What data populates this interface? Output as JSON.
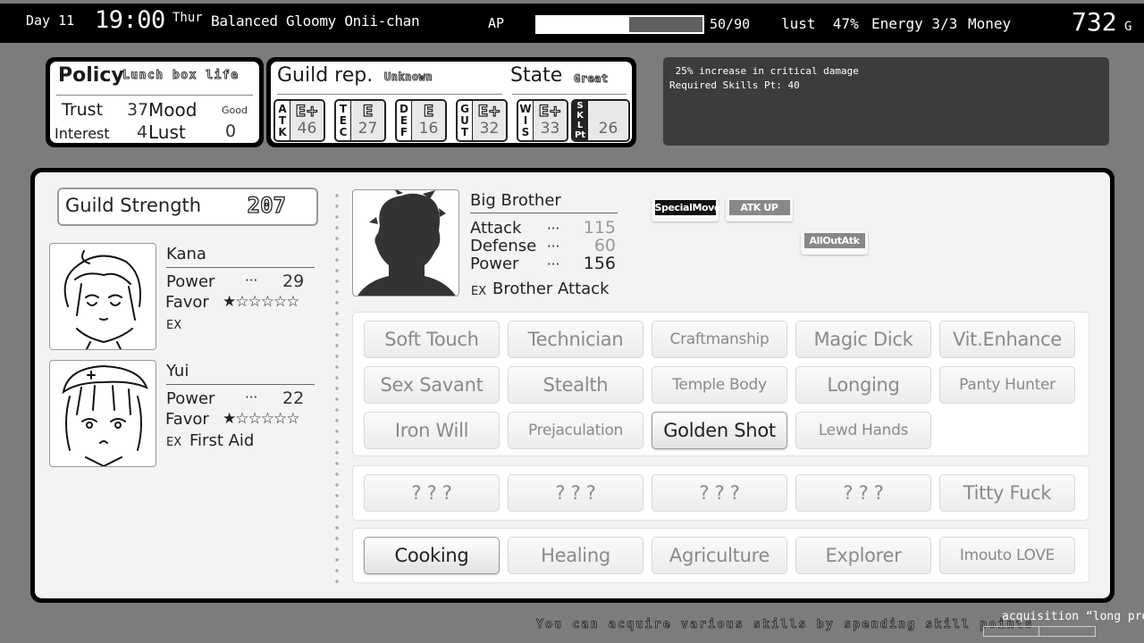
{
  "topbar": {
    "day": "Day 11",
    "time": "19:00",
    "weekday": "Thur",
    "title": "Balanced Gloomy Onii-chan",
    "ap_label": "AP",
    "ap_current": 50,
    "ap_max": 90,
    "ap_text": "50/90",
    "lust_text": "lust  47%",
    "energy_text": "Energy 3/3",
    "money_label": "Money",
    "money": "732",
    "currency": "G"
  },
  "policy": {
    "title": "Policy",
    "name": "Lunch box life",
    "trust_label": "Trust",
    "trust": "37",
    "mood_label": "Mood",
    "mood": "Good",
    "interest_label": "Interest",
    "interest": "4",
    "lust_label": "Lust",
    "lust": "0"
  },
  "guild": {
    "rep_label": "Guild rep.",
    "rep_value": "Unknown",
    "state_label": "State",
    "state_value": "Great",
    "stats": [
      {
        "key": [
          "A",
          "T",
          "K"
        ],
        "grade": "E+",
        "value": "46"
      },
      {
        "key": [
          "T",
          "E",
          "C"
        ],
        "grade": "E",
        "value": "27"
      },
      {
        "key": [
          "D",
          "E",
          "F"
        ],
        "grade": "E",
        "value": "16"
      },
      {
        "key": [
          "G",
          "U",
          "T"
        ],
        "grade": "E+",
        "value": "32"
      },
      {
        "key": [
          "W",
          "I",
          "S"
        ],
        "grade": "E+",
        "value": "33"
      }
    ],
    "skill_pt": {
      "key": [
        "S",
        "K",
        "L",
        "Pt"
      ],
      "value": "26"
    }
  },
  "description": {
    "line1": " 25% increase in critical damage",
    "line2": "Required Skills Pt: 40"
  },
  "guild_strength": {
    "label": "Guild Strength",
    "value": "207"
  },
  "members": [
    {
      "name": "Kana",
      "power_label": "Power",
      "dots": "···",
      "power": "29",
      "favor_label": "Favor",
      "favor_stars": 1,
      "favor_max": 6,
      "stars_text": "★☆☆☆☆☆",
      "ex_label": "EX",
      "ex_skill": ""
    },
    {
      "name": "Yui",
      "power_label": "Power",
      "dots": "···",
      "power": "22",
      "favor_label": "Favor",
      "favor_stars": 1,
      "favor_max": 6,
      "stars_text": "★☆☆☆☆☆",
      "ex_label": "EX",
      "ex_skill": "First Aid"
    }
  ],
  "hero": {
    "name": "Big Brother",
    "attack_label": "Attack",
    "attack": "115",
    "defense_label": "Defense",
    "defense": "60",
    "power_label": "Power",
    "power": "156",
    "dots": "···",
    "ex_label": "EX",
    "ex_skill": "Brother Attack",
    "tags": [
      {
        "label": "SpecialMove",
        "active": true
      },
      {
        "label": "ATK UP",
        "active": false
      },
      {
        "label": "AllOutAtk",
        "active": false
      }
    ]
  },
  "skills": {
    "group1": [
      {
        "label": "Soft Touch",
        "owned": false
      },
      {
        "label": "Technician",
        "owned": false
      },
      {
        "label": "Craftmanship",
        "owned": false
      },
      {
        "label": "Magic Dick",
        "owned": false
      },
      {
        "label": "Vit.Enhance",
        "owned": false
      },
      {
        "label": "Sex Savant",
        "owned": false
      },
      {
        "label": "Stealth",
        "owned": false
      },
      {
        "label": "Temple Body",
        "owned": false
      },
      {
        "label": "Longing",
        "owned": false
      },
      {
        "label": "Panty Hunter",
        "owned": false
      },
      {
        "label": "Iron Will",
        "owned": false
      },
      {
        "label": "Prejaculation",
        "owned": false
      },
      {
        "label": "Golden Shot",
        "owned": true
      },
      {
        "label": "Lewd Hands",
        "owned": false
      }
    ],
    "group2": [
      {
        "label": "? ? ?",
        "owned": false
      },
      {
        "label": "? ? ?",
        "owned": false
      },
      {
        "label": "? ? ?",
        "owned": false
      },
      {
        "label": "? ? ?",
        "owned": false
      },
      {
        "label": "Titty Fuck",
        "owned": false
      }
    ],
    "group3": [
      {
        "label": "Cooking",
        "owned": true
      },
      {
        "label": "Healing",
        "owned": false
      },
      {
        "label": "Agriculture",
        "owned": false
      },
      {
        "label": "Explorer",
        "owned": false
      },
      {
        "label": "Imouto LOVE",
        "owned": false
      }
    ]
  },
  "footer": {
    "hint": "You can acquire various skills by spending skill points",
    "ticker": "acquisition “long pre"
  }
}
